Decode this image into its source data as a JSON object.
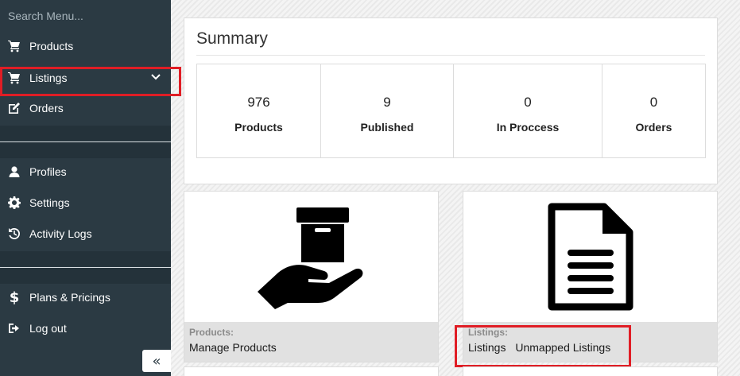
{
  "sidebar": {
    "search_placeholder": "Search Menu...",
    "items": [
      {
        "label": "Products",
        "icon": "cart-icon"
      },
      {
        "label": "Listings",
        "icon": "cart-icon"
      },
      {
        "label": "Orders",
        "icon": "edit-icon"
      },
      {
        "label": "Profiles",
        "icon": "user-icon"
      },
      {
        "label": "Settings",
        "icon": "gear-icon"
      },
      {
        "label": "Activity Logs",
        "icon": "history-icon"
      },
      {
        "label": "Plans & Pricings",
        "icon": "dollar-icon"
      },
      {
        "label": "Log out",
        "icon": "sign-out-icon"
      }
    ],
    "collapse_glyph": "«"
  },
  "summary": {
    "title": "Summary",
    "stats": [
      {
        "value": "976",
        "label": "Products"
      },
      {
        "value": "9",
        "label": "Published"
      },
      {
        "value": "0",
        "label": "In Proccess"
      },
      {
        "value": "0",
        "label": "Orders"
      }
    ]
  },
  "cards": {
    "products": {
      "title": "Products:",
      "links": [
        "Manage Products"
      ],
      "icon": "box-in-hand-icon"
    },
    "listings": {
      "title": "Listings:",
      "links": [
        "Listings",
        "Unmapped Listings"
      ],
      "icon": "document-icon"
    }
  },
  "colors": {
    "sidebar": "#2b3a43",
    "highlight": "#e01d25",
    "card_footer": "#e1e1e1"
  }
}
